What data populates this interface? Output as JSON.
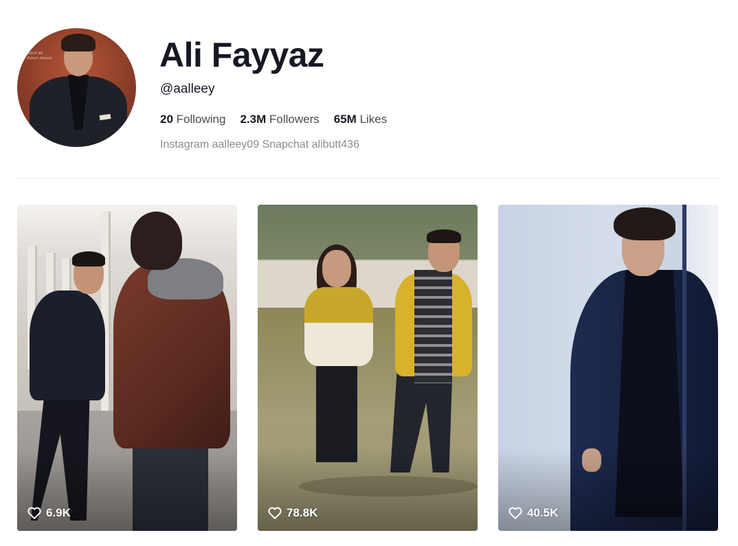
{
  "profile": {
    "name": "Ali Fayyaz",
    "handle": "@aalleey",
    "avatar_watermark": "SHOT BY Zubair Ahmad",
    "stats": [
      {
        "value": "20",
        "label": "Following"
      },
      {
        "value": "2.3M",
        "label": "Followers"
      },
      {
        "value": "65M",
        "label": "Likes"
      }
    ],
    "bio": "Instagram aalleey09 Snapchat alibutt436"
  },
  "videos": [
    {
      "likes": "6.9K"
    },
    {
      "likes": "78.8K"
    },
    {
      "likes": "40.5K"
    }
  ],
  "colors": {
    "text_primary": "#161823",
    "text_secondary": "#8a8b91",
    "divider": "#ececec"
  },
  "icons": {
    "likes": "heart-outline-icon"
  }
}
